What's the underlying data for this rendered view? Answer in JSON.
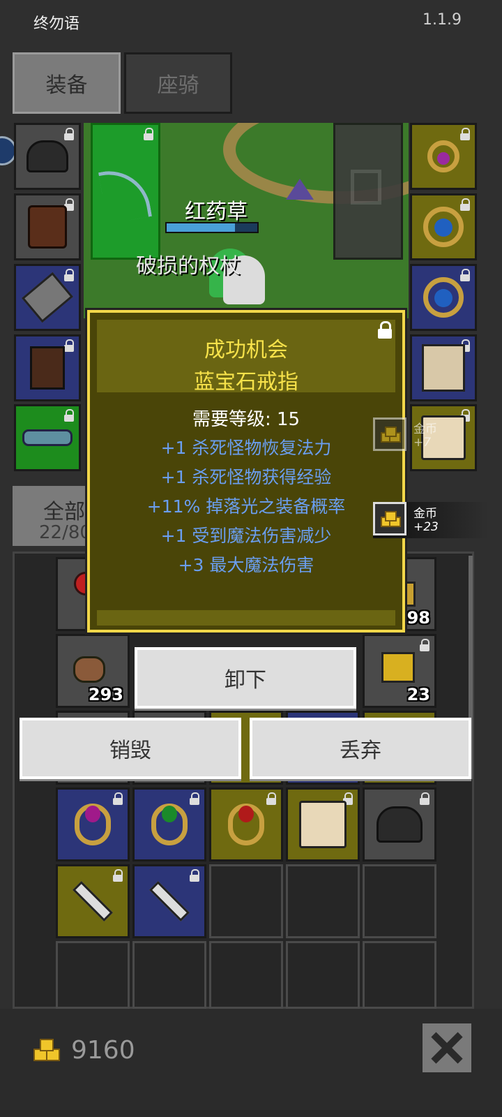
{
  "app": {
    "title": "终勿语",
    "version": "1.1.9"
  },
  "tabs": {
    "equipment": "装备",
    "mount": "座骑"
  },
  "scene": {
    "target_name": "红药草",
    "target_hp_fraction": 0.75,
    "weapon_label": "破损的权杖"
  },
  "tooltip": {
    "title": "成功机会",
    "item_name": "蓝宝石戒指",
    "requirement": "需要等级: 15",
    "stats": [
      "+1 杀死怪物恢复法力",
      "+1 杀死怪物获得经验",
      "+11% 掉落光之装备概率",
      "+1 受到魔法伤害减少",
      "+3 最大魔法伤害"
    ]
  },
  "pickups": [
    {
      "name": "金币",
      "amount": "+7"
    },
    {
      "name": "金币",
      "amount": "+23"
    }
  ],
  "inventory": {
    "filter_label": "全部",
    "filter_count": "22/80",
    "counts": {
      "coal": "298",
      "meat": "293",
      "cheese": "23"
    }
  },
  "actions": {
    "unequip": "卸下",
    "destroy": "销毁",
    "drop": "丢弃"
  },
  "footer": {
    "gold": "9160"
  },
  "colors": {
    "tooltip_border": "#f2d74a",
    "stat_text": "#6a9ef0",
    "title_text": "#f7e24a"
  }
}
